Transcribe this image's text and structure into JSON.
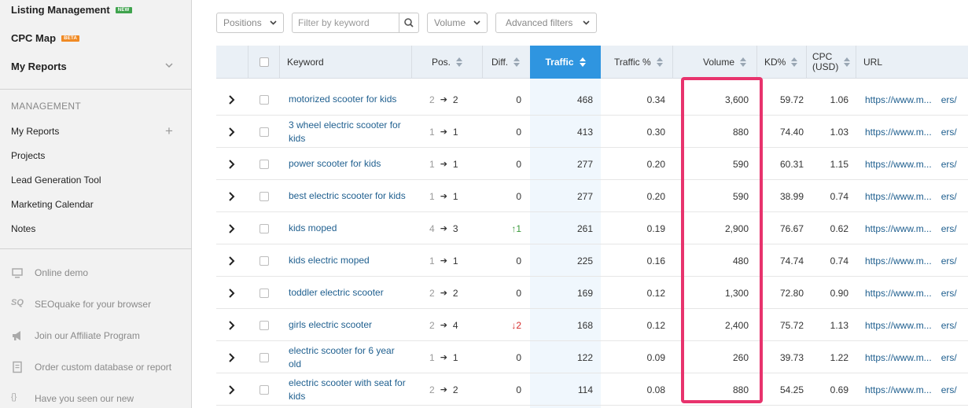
{
  "sidebar": {
    "top_items": [
      {
        "label": "Listing Management",
        "badge": "NEW"
      },
      {
        "label": "CPC Map",
        "badge": "BETA"
      },
      {
        "label": "My Reports"
      }
    ],
    "management_title": "MANAGEMENT",
    "management_items": [
      "My Reports",
      "Projects",
      "Lead Generation Tool",
      "Marketing Calendar",
      "Notes"
    ],
    "utility_items": [
      {
        "label": "Online demo",
        "icon": "monitor-icon"
      },
      {
        "label": "SEOquake for your browser",
        "icon": "seoquake-icon",
        "icon_text": "SQ"
      },
      {
        "label": "Join our Affiliate Program",
        "icon": "megaphone-icon"
      },
      {
        "label": "Order custom database or report",
        "icon": "document-icon"
      },
      {
        "label": "Have you seen our new",
        "icon": "braces-icon",
        "icon_text": "{}"
      }
    ]
  },
  "filters": {
    "positions": "Positions",
    "keyword_placeholder": "Filter by keyword",
    "volume": "Volume",
    "advanced": "Advanced filters"
  },
  "table": {
    "headers": {
      "keyword": "Keyword",
      "pos": "Pos.",
      "diff": "Diff.",
      "traffic": "Traffic",
      "traffic_pct": "Traffic %",
      "volume": "Volume",
      "kd": "KD%",
      "cpc_line1": "CPC",
      "cpc_line2": "(USD)",
      "url": "URL"
    },
    "rows": [
      {
        "keyword": "motorized scooter for kids",
        "pos_from": "2",
        "pos_to": "2",
        "diff": "0",
        "diff_dir": "none",
        "traffic": "468",
        "traffic_pct": "0.34",
        "volume": "3,600",
        "kd": "59.72",
        "cpc": "1.06",
        "url": "https://www.m...",
        "url_tail": "ers/"
      },
      {
        "keyword": "3 wheel electric scooter for kids",
        "pos_from": "1",
        "pos_to": "1",
        "diff": "0",
        "diff_dir": "none",
        "traffic": "413",
        "traffic_pct": "0.30",
        "volume": "880",
        "kd": "74.40",
        "cpc": "1.03",
        "url": "https://www.m...",
        "url_tail": "ers/"
      },
      {
        "keyword": "power scooter for kids",
        "pos_from": "1",
        "pos_to": "1",
        "diff": "0",
        "diff_dir": "none",
        "traffic": "277",
        "traffic_pct": "0.20",
        "volume": "590",
        "kd": "60.31",
        "cpc": "1.15",
        "url": "https://www.m...",
        "url_tail": "ers/"
      },
      {
        "keyword": "best electric scooter for kids",
        "pos_from": "1",
        "pos_to": "1",
        "diff": "0",
        "diff_dir": "none",
        "traffic": "277",
        "traffic_pct": "0.20",
        "volume": "590",
        "kd": "38.99",
        "cpc": "0.74",
        "url": "https://www.m...",
        "url_tail": "ers/"
      },
      {
        "keyword": "kids moped",
        "pos_from": "4",
        "pos_to": "3",
        "diff": "↑1",
        "diff_dir": "up",
        "traffic": "261",
        "traffic_pct": "0.19",
        "volume": "2,900",
        "kd": "76.67",
        "cpc": "0.62",
        "url": "https://www.m...",
        "url_tail": "ers/"
      },
      {
        "keyword": "kids electric moped",
        "pos_from": "1",
        "pos_to": "1",
        "diff": "0",
        "diff_dir": "none",
        "traffic": "225",
        "traffic_pct": "0.16",
        "volume": "480",
        "kd": "74.74",
        "cpc": "0.74",
        "url": "https://www.m...",
        "url_tail": "ers/"
      },
      {
        "keyword": "toddler electric scooter",
        "pos_from": "2",
        "pos_to": "2",
        "diff": "0",
        "diff_dir": "none",
        "traffic": "169",
        "traffic_pct": "0.12",
        "volume": "1,300",
        "kd": "72.80",
        "cpc": "0.90",
        "url": "https://www.m...",
        "url_tail": "ers/"
      },
      {
        "keyword": "girls electric scooter",
        "pos_from": "2",
        "pos_to": "4",
        "diff": "↓2",
        "diff_dir": "down",
        "traffic": "168",
        "traffic_pct": "0.12",
        "volume": "2,400",
        "kd": "75.72",
        "cpc": "1.13",
        "url": "https://www.m...",
        "url_tail": "ers/"
      },
      {
        "keyword": "electric scooter for 6 year old",
        "pos_from": "1",
        "pos_to": "1",
        "diff": "0",
        "diff_dir": "none",
        "traffic": "122",
        "traffic_pct": "0.09",
        "volume": "260",
        "kd": "39.73",
        "cpc": "1.22",
        "url": "https://www.m...",
        "url_tail": "ers/"
      },
      {
        "keyword": "electric scooter with seat for kids",
        "pos_from": "2",
        "pos_to": "2",
        "diff": "0",
        "diff_dir": "none",
        "traffic": "114",
        "traffic_pct": "0.08",
        "volume": "880",
        "kd": "54.25",
        "cpc": "0.69",
        "url": "https://www.m...",
        "url_tail": "ers/"
      }
    ]
  },
  "colors": {
    "accent": "#2f95e0",
    "link": "#1f5f8f",
    "highlight": "#e8336d",
    "up": "#3a9a3a",
    "down": "#d62c2c"
  }
}
